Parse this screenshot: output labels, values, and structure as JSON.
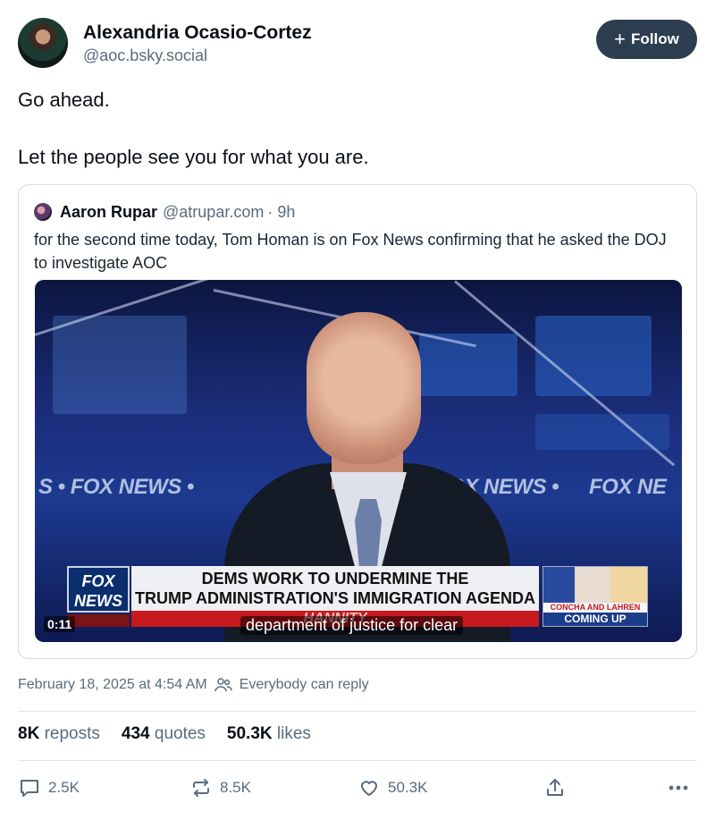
{
  "author": {
    "name": "Alexandria Ocasio-Cortez",
    "handle": "@aoc.bsky.social",
    "follow_label": "Follow",
    "follow_icon": "plus-icon"
  },
  "post": {
    "line1": "Go ahead.",
    "line2": "Let the people see you for what you are."
  },
  "quote": {
    "name": "Aaron Rupar",
    "handle": "@atrupar.com",
    "age": "· 9h",
    "text": "for the second time today, Tom Homan is on Fox News confirming that he asked the DOJ to investigate AOC",
    "video": {
      "wall_text_1": "S  •  FOX NEWS  •",
      "wall_text_2": "FOX NEWS  •",
      "wall_text_3": "FOX NE",
      "logo_top": "FOX",
      "logo_bottom": "NEWS",
      "channel": "channel",
      "headline_1": "DEMS WORK TO UNDERMINE THE",
      "headline_2": "TRUMP ADMINISTRATION'S IMMIGRATION AGENDA",
      "show": "HANNITY",
      "promo_names": "CONCHA AND LAHREN",
      "promo_label": "COMING UP",
      "timecode": "0:11",
      "caption": "department of justice for clear"
    }
  },
  "meta": {
    "date": "February 18, 2025 at 4:54 AM",
    "reply_setting": "Everybody can reply"
  },
  "stats": {
    "reposts_count": "8K",
    "reposts_label": "reposts",
    "quotes_count": "434",
    "quotes_label": "quotes",
    "likes_count": "50.3K",
    "likes_label": "likes"
  },
  "actions": {
    "reply_count": "2.5K",
    "repost_count": "8.5K",
    "like_count": "50.3K"
  }
}
